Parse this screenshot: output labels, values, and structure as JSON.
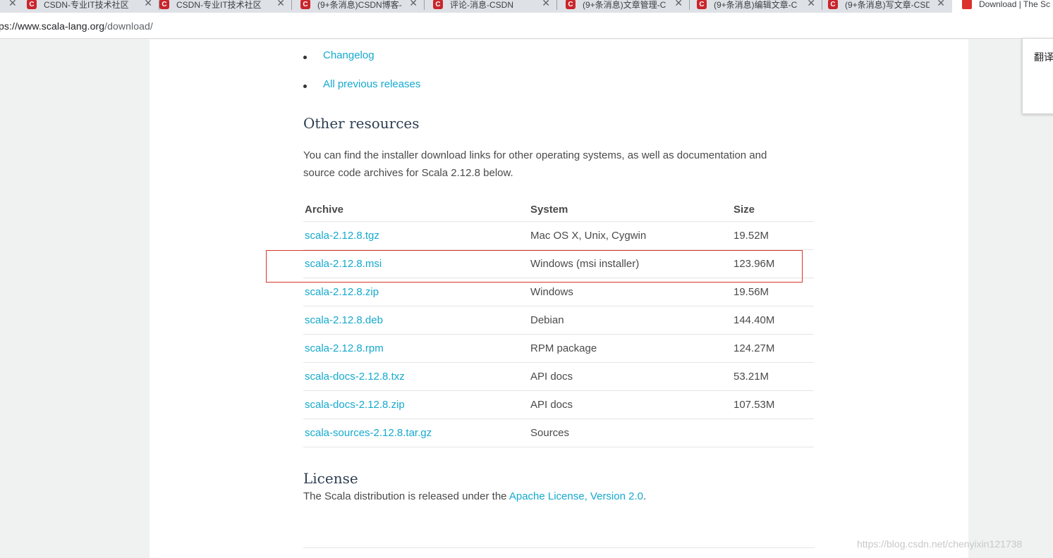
{
  "browser": {
    "tabs": [
      {
        "title": "CSDN-专业IT技术社区",
        "favicon": "C",
        "active": false
      },
      {
        "title": "CSDN-专业IT技术社区",
        "favicon": "C",
        "active": false
      },
      {
        "title": "(9+条消息)CSDN博客-",
        "favicon": "C",
        "active": false
      },
      {
        "title": "评论-消息-CSDN",
        "favicon": "C",
        "active": false
      },
      {
        "title": "(9+条消息)文章管理-C",
        "favicon": "C",
        "active": false
      },
      {
        "title": "(9+条消息)编辑文章-C",
        "favicon": "C",
        "active": false
      },
      {
        "title": "(9+条消息)写文章-CSD",
        "favicon": "C",
        "active": false
      },
      {
        "title": "Download | The Sc",
        "favicon": "",
        "active": true
      }
    ],
    "url_host": "tps://www.scala-lang.org",
    "url_path": "/download/"
  },
  "links": {
    "changelog": "Changelog",
    "previous_releases": "All previous releases"
  },
  "other_resources": {
    "heading": "Other resources",
    "description": "You can find the installer download links for other operating systems, as well as documentation and source code archives for Scala 2.12.8 below."
  },
  "table": {
    "headers": {
      "archive": "Archive",
      "system": "System",
      "size": "Size"
    },
    "rows": [
      {
        "archive": "scala-2.12.8.tgz",
        "system": "Mac OS X, Unix, Cygwin",
        "size": "19.52M"
      },
      {
        "archive": "scala-2.12.8.msi",
        "system": "Windows (msi installer)",
        "size": "123.96M"
      },
      {
        "archive": "scala-2.12.8.zip",
        "system": "Windows",
        "size": "19.56M"
      },
      {
        "archive": "scala-2.12.8.deb",
        "system": "Debian",
        "size": "144.40M"
      },
      {
        "archive": "scala-2.12.8.rpm",
        "system": "RPM package",
        "size": "124.27M"
      },
      {
        "archive": "scala-docs-2.12.8.txz",
        "system": "API docs",
        "size": "53.21M"
      },
      {
        "archive": "scala-docs-2.12.8.zip",
        "system": "API docs",
        "size": "107.53M"
      },
      {
        "archive": "scala-sources-2.12.8.tar.gz",
        "system": "Sources",
        "size": ""
      }
    ]
  },
  "license": {
    "heading": "License",
    "text_before": "The Scala distribution is released under the ",
    "link": "Apache License, Version 2.0",
    "text_after": "."
  },
  "translate_popup": {
    "label": "翻译"
  },
  "watermark": "https://blog.csdn.net/chenyixin121738",
  "colors": {
    "link": "#15a9ce",
    "highlight_box": "#d9362c",
    "tab_favicon": "#c9252c"
  }
}
